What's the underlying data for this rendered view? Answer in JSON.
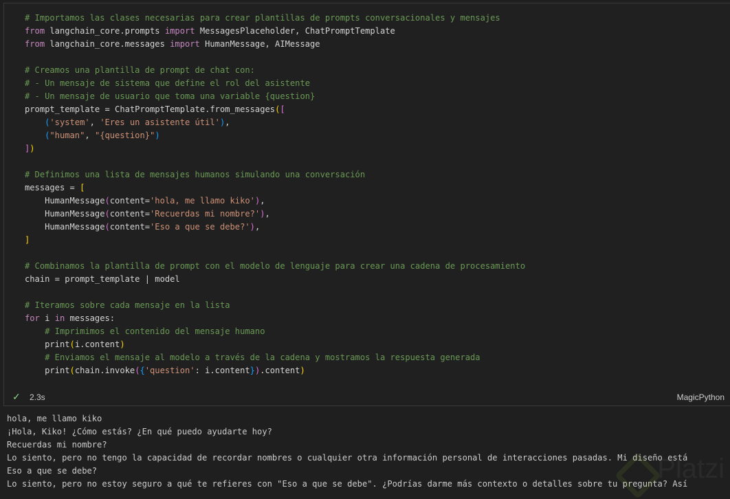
{
  "cell": {
    "code_lines": [
      [
        [
          "c",
          "# Importamos las clases necesarias para crear plantillas de prompts conversacionales y mensajes"
        ]
      ],
      [
        [
          "k",
          "from"
        ],
        [
          "t",
          " langchain_core.prompts "
        ],
        [
          "k",
          "import"
        ],
        [
          "t",
          " MessagesPlaceholder, ChatPromptTemplate"
        ]
      ],
      [
        [
          "k",
          "from"
        ],
        [
          "t",
          " langchain_core.messages "
        ],
        [
          "k",
          "import"
        ],
        [
          "t",
          " HumanMessage, AIMessage"
        ]
      ],
      [],
      [
        [
          "c",
          "# Creamos una plantilla de prompt de chat con:"
        ]
      ],
      [
        [
          "c",
          "# - Un mensaje de sistema que define el rol del asistente"
        ]
      ],
      [
        [
          "c",
          "# - Un mensaje de usuario que toma una variable {question}"
        ]
      ],
      [
        [
          "t",
          "prompt_template = ChatPromptTemplate.from_messages"
        ],
        [
          "b1",
          "("
        ],
        [
          "b2",
          "["
        ]
      ],
      [
        [
          "t",
          "    "
        ],
        [
          "b3",
          "("
        ],
        [
          "s",
          "'system'"
        ],
        [
          "t",
          ", "
        ],
        [
          "s",
          "'Eres un asistente útil'"
        ],
        [
          "b3",
          ")"
        ],
        [
          "t",
          ","
        ]
      ],
      [
        [
          "t",
          "    "
        ],
        [
          "b3",
          "("
        ],
        [
          "s",
          "\"human\""
        ],
        [
          "t",
          ", "
        ],
        [
          "s",
          "\"{question}\""
        ],
        [
          "b3",
          ")"
        ]
      ],
      [
        [
          "b2",
          "]"
        ],
        [
          "b1",
          ")"
        ]
      ],
      [],
      [
        [
          "c",
          "# Definimos una lista de mensajes humanos simulando una conversación"
        ]
      ],
      [
        [
          "t",
          "messages = "
        ],
        [
          "b1",
          "["
        ]
      ],
      [
        [
          "t",
          "    HumanMessage"
        ],
        [
          "b2",
          "("
        ],
        [
          "t",
          "content="
        ],
        [
          "s",
          "'hola, me llamo kiko'"
        ],
        [
          "b2",
          ")"
        ],
        [
          "t",
          ","
        ]
      ],
      [
        [
          "t",
          "    HumanMessage"
        ],
        [
          "b2",
          "("
        ],
        [
          "t",
          "content="
        ],
        [
          "s",
          "'Recuerdas mi nombre?'"
        ],
        [
          "b2",
          ")"
        ],
        [
          "t",
          ","
        ]
      ],
      [
        [
          "t",
          "    HumanMessage"
        ],
        [
          "b2",
          "("
        ],
        [
          "t",
          "content="
        ],
        [
          "s",
          "'Eso a que se debe?'"
        ],
        [
          "b2",
          ")"
        ],
        [
          "t",
          ","
        ]
      ],
      [
        [
          "b1",
          "]"
        ]
      ],
      [],
      [
        [
          "c",
          "# Combinamos la plantilla de prompt con el modelo de lenguaje para crear una cadena de procesamiento"
        ]
      ],
      [
        [
          "t",
          "chain = prompt_template | model"
        ]
      ],
      [],
      [
        [
          "c",
          "# Iteramos sobre cada mensaje en la lista"
        ]
      ],
      [
        [
          "k",
          "for"
        ],
        [
          "t",
          " i "
        ],
        [
          "k",
          "in"
        ],
        [
          "t",
          " messages:"
        ]
      ],
      [
        [
          "t",
          "    "
        ],
        [
          "c",
          "# Imprimimos el contenido del mensaje humano"
        ]
      ],
      [
        [
          "t",
          "    print"
        ],
        [
          "b1",
          "("
        ],
        [
          "t",
          "i.content"
        ],
        [
          "b1",
          ")"
        ]
      ],
      [
        [
          "t",
          "    "
        ],
        [
          "c",
          "# Enviamos el mensaje al modelo a través de la cadena y mostramos la respuesta generada"
        ]
      ],
      [
        [
          "t",
          "    print"
        ],
        [
          "b1",
          "("
        ],
        [
          "t",
          "chain.invoke"
        ],
        [
          "b2",
          "("
        ],
        [
          "b3",
          "{"
        ],
        [
          "s",
          "'question'"
        ],
        [
          "t",
          ": i.content"
        ],
        [
          "b3",
          "}"
        ],
        [
          "b2",
          ")"
        ],
        [
          "t",
          ".content"
        ],
        [
          "b1",
          ")"
        ]
      ]
    ],
    "status": {
      "icon": "check-icon",
      "duration": "2.3s",
      "language": "MagicPython"
    }
  },
  "output_lines": [
    "hola, me llamo kiko",
    "¡Hola, Kiko! ¿Cómo estás? ¿En qué puedo ayudarte hoy?",
    "Recuerdas mi nombre?",
    "Lo siento, pero no tengo la capacidad de recordar nombres o cualquier otra información personal de interacciones pasadas. Mi diseño está",
    "Eso a que se debe?",
    "Lo siento, pero no estoy seguro a qué te refieres con \"Eso a que se debe\". ¿Podrías darme más contexto o detalles sobre tu pregunta? Así"
  ],
  "watermark": "Platzi",
  "colors": {
    "comment": "#6a9955",
    "keyword": "#c586c0",
    "string": "#ce9178",
    "success": "#89d185"
  }
}
